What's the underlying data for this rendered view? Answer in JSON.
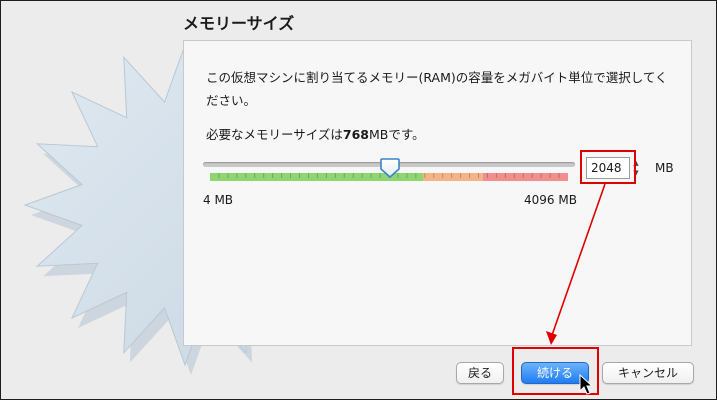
{
  "dialog": {
    "title": "メモリーサイズ",
    "description": "この仮想マシンに割り当てるメモリー(RAM)の容量をメガバイト単位で選択してください。",
    "recommended_prefix": "必要なメモリーサイズは",
    "recommended_value": "768",
    "recommended_suffix": "MBです。"
  },
  "memory": {
    "value": "2048",
    "unit": "MB",
    "min_label": "4 MB",
    "max_label": "4096 MB",
    "slider_level_fraction": 0.5
  },
  "buttons": {
    "back": "戻る",
    "continue": "続ける",
    "cancel": "キャンセル"
  },
  "colors": {
    "safe": "#8fd672",
    "warning": "#f4b48a",
    "danger": "#f18e8e",
    "primary": "#1f7cf3",
    "highlight": "#e00000"
  }
}
